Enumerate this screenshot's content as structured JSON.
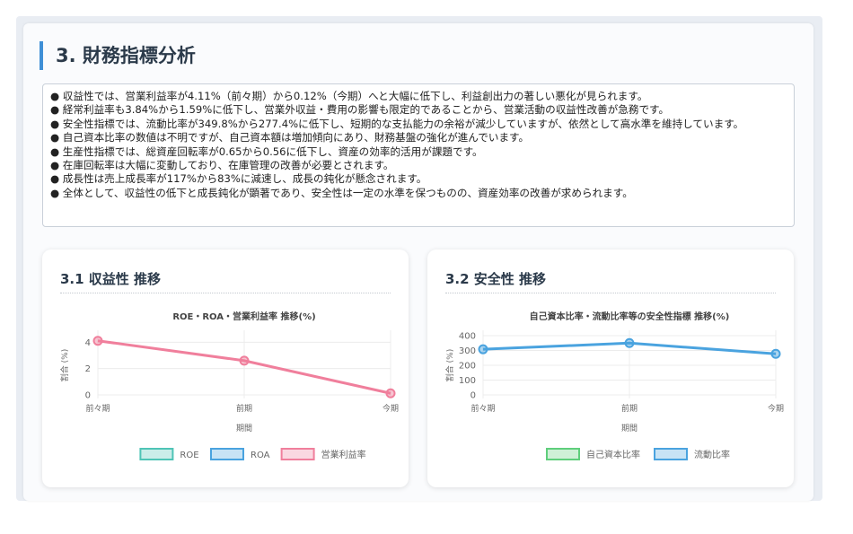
{
  "section": {
    "title": "3. 財務指標分析"
  },
  "summary": {
    "lines": [
      "● 収益性では、営業利益率が4.11%（前々期）から0.12%（今期）へと大幅に低下し、利益創出力の著しい悪化が見られます。",
      "● 経常利益率も3.84%から1.59%に低下し、営業外収益・費用の影響も限定的であることから、営業活動の収益性改善が急務です。",
      "● 安全性指標では、流動比率が349.8%から277.4%に低下し、短期的な支払能力の余裕が減少していますが、依然として高水準を維持しています。",
      "● 自己資本比率の数値は不明ですが、自己資本額は増加傾向にあり、財務基盤の強化が進んでいます。",
      "● 生産性指標では、総資産回転率が0.65から0.56に低下し、資産の効率的活用が課題です。",
      "● 在庫回転率は大幅に変動しており、在庫管理の改善が必要とされます。",
      "● 成長性は売上成長率が117%から83%に減速し、成長の鈍化が懸念されます。",
      "● 全体として、収益性の低下と成長鈍化が顕著であり、安全性は一定の水準を保つものの、資産効率の改善が求められます。"
    ]
  },
  "cards": {
    "left_title": "3.1 収益性 推移",
    "right_title": "3.2 安全性 推移"
  },
  "chart_data": [
    {
      "type": "line",
      "title": "ROE・ROA・営業利益率 推移(%)",
      "xlabel": "期間",
      "ylabel": "割合 (%)",
      "categories": [
        "前々期",
        "前期",
        "今期"
      ],
      "ylim": [
        0,
        4.5
      ],
      "yticks": [
        0,
        2,
        4
      ],
      "grid": true,
      "legend_position": "bottom",
      "series": [
        {
          "name": "ROE",
          "color": "#4fc4b6",
          "values": []
        },
        {
          "name": "ROA",
          "color": "#4aa3df",
          "values": []
        },
        {
          "name": "営業利益率",
          "color": "#f07f9c",
          "values": [
            4.11,
            2.6,
            0.12
          ]
        }
      ]
    },
    {
      "type": "line",
      "title": "自己資本比率・流動比率等の安全性指標 推移(%)",
      "xlabel": "期間",
      "ylabel": "割合 (%)",
      "categories": [
        "前々期",
        "前期",
        "今期"
      ],
      "ylim": [
        0,
        400
      ],
      "yticks": [
        0,
        100,
        200,
        300,
        400
      ],
      "grid": true,
      "legend_position": "bottom",
      "series": [
        {
          "name": "自己資本比率",
          "color": "#5fce7c",
          "values": []
        },
        {
          "name": "流動比率",
          "color": "#4aa3df",
          "values": [
            308,
            349.8,
            277.4
          ]
        }
      ]
    }
  ]
}
